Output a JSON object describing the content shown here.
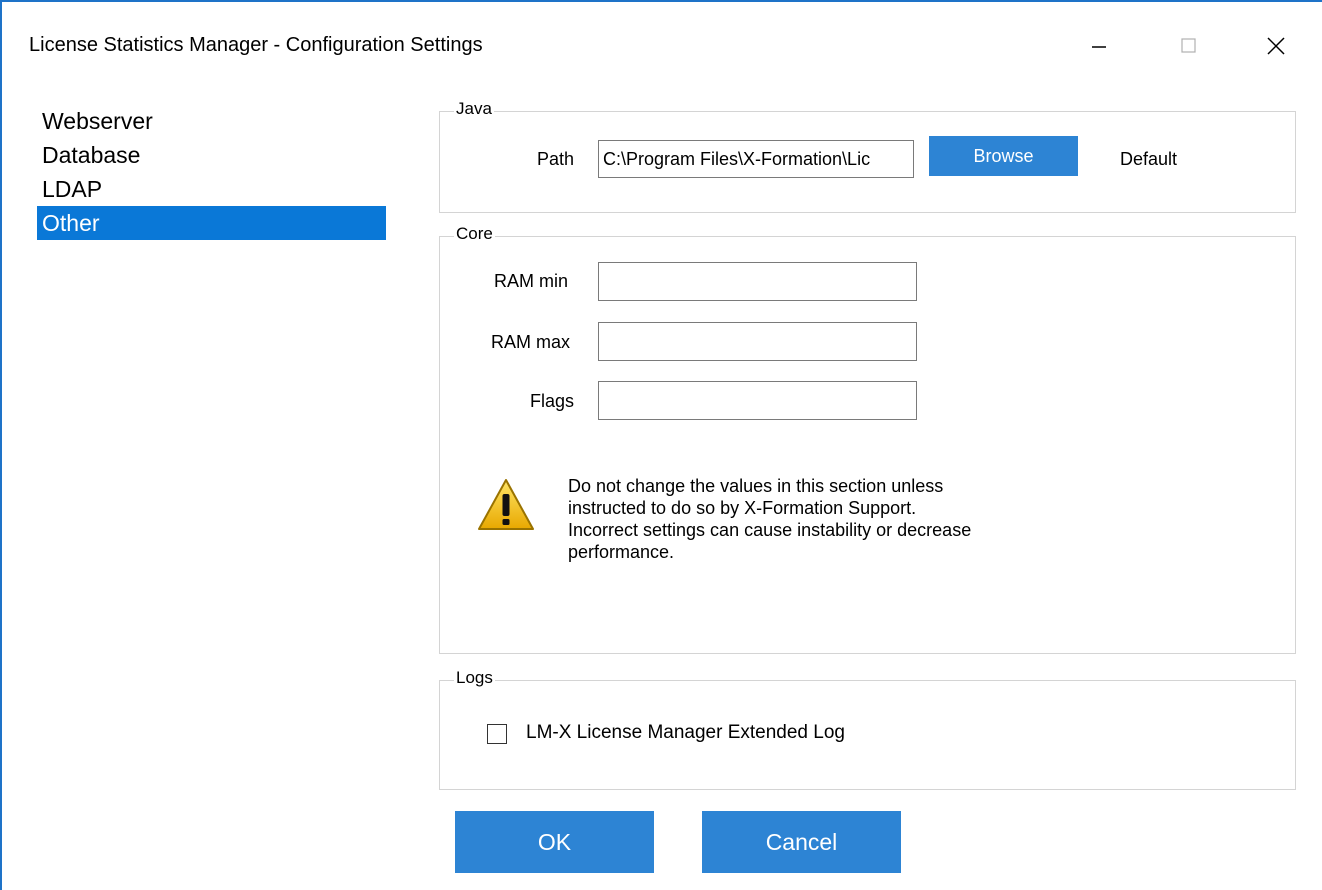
{
  "window": {
    "title": "License Statistics Manager - Configuration Settings",
    "minimize_glyph": "—",
    "maximize_glyph": "☐",
    "close_glyph": "✕"
  },
  "nav": {
    "items": [
      {
        "label": "Webserver",
        "selected": false
      },
      {
        "label": "Database",
        "selected": false
      },
      {
        "label": "LDAP",
        "selected": false
      },
      {
        "label": "Other",
        "selected": true
      }
    ]
  },
  "java": {
    "group_label": "Java",
    "path_label": "Path",
    "path_value": "C:\\Program Files\\X-Formation\\Lic",
    "browse_label": "Browse",
    "default_label": "Default"
  },
  "core": {
    "group_label": "Core",
    "ram_min_label": "RAM min",
    "ram_min_value": "",
    "ram_max_label": "RAM max",
    "ram_max_value": "",
    "flags_label": "Flags",
    "flags_value": "",
    "warning_icon": "warning-triangle-icon",
    "warning_text": "Do not change the values in this section unless instructed to do so by X-Formation Support. Incorrect settings can cause instability or decrease performance."
  },
  "logs": {
    "group_label": "Logs",
    "extended_log_label": "LM-X License Manager Extended Log",
    "extended_log_checked": false
  },
  "footer": {
    "ok_label": "OK",
    "cancel_label": "Cancel"
  },
  "colors": {
    "accent": "#0a78d7",
    "button": "#2d84d4",
    "border_accent": "#1e73c8",
    "group_border": "#d4d4d4",
    "warning_yellow": "#f2c200"
  }
}
